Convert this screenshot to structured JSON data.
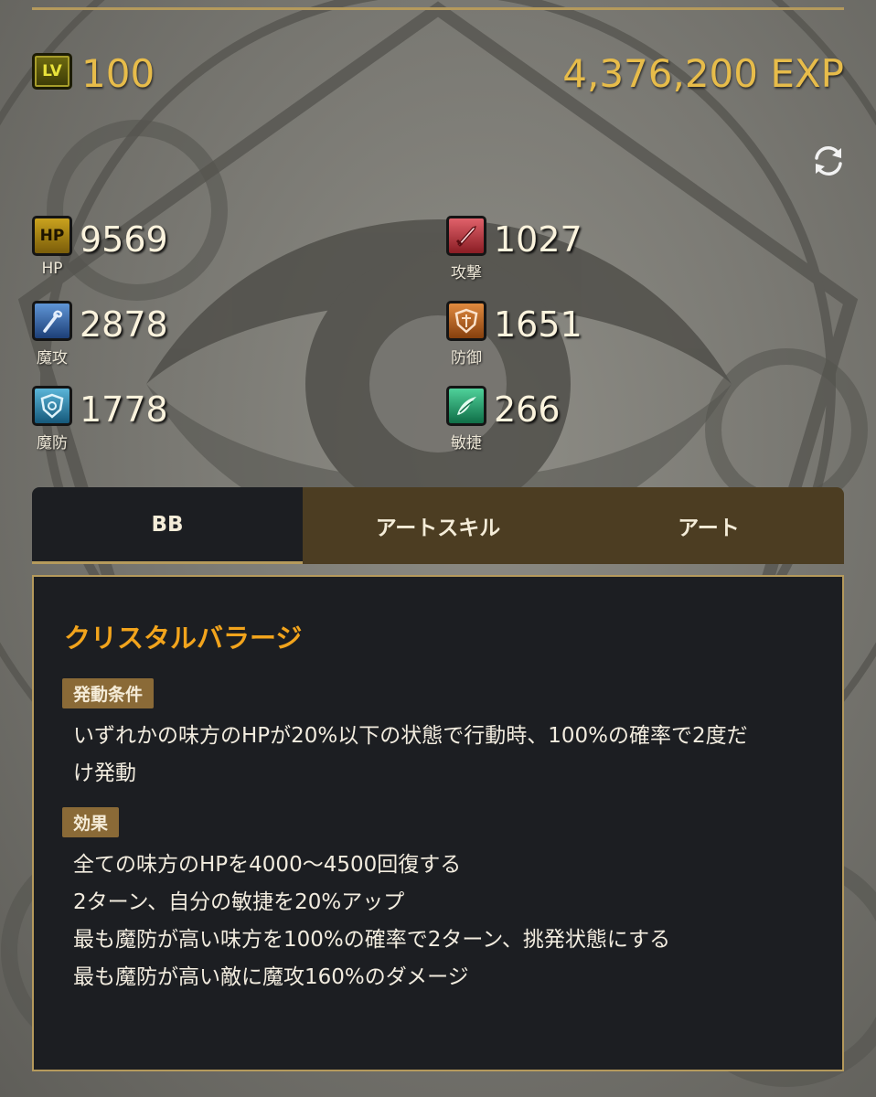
{
  "level": {
    "icon_text": "LV",
    "value": "100",
    "exp": "4,376,200 EXP"
  },
  "stats": {
    "hp": {
      "icon": "hp-icon",
      "icon_text": "HP",
      "label": "HP",
      "value": "9569"
    },
    "atk": {
      "icon": "sword-icon",
      "label": "攻撃",
      "value": "1027"
    },
    "matk": {
      "icon": "staff-icon",
      "label": "魔攻",
      "value": "2878"
    },
    "def": {
      "icon": "shield-icon",
      "label": "防御",
      "value": "1651"
    },
    "mdef": {
      "icon": "magic-shield-icon",
      "label": "魔防",
      "value": "1778"
    },
    "agi": {
      "icon": "wing-icon",
      "label": "敏捷",
      "value": "266"
    }
  },
  "tabs": [
    {
      "label": "BB",
      "active": true
    },
    {
      "label": "アートスキル",
      "active": false
    },
    {
      "label": "アート",
      "active": false
    }
  ],
  "skill": {
    "name": "クリスタルバラージ",
    "condition_label": "発動条件",
    "condition_lines": [
      "いずれかの味方のHPが20%以下の状態で行動時、100%の確率で2度だ",
      "け発動"
    ],
    "effect_label": "効果",
    "effect_lines": [
      "全ての味方のHPを4000〜4500回復する",
      "2ターン、自分の敏捷を20%アップ",
      "最も魔防が高い味方を100%の確率で2ターン、挑発状態にする",
      "最も魔防が高い敵に魔攻160%のダメージ"
    ]
  },
  "colors": {
    "accent_gold": "#e7bc4a",
    "skill_title": "#f2a41c",
    "badge": "#8a6a37",
    "panel_bg": "#1c1e22",
    "tab_inactive": "#4c3d22"
  }
}
